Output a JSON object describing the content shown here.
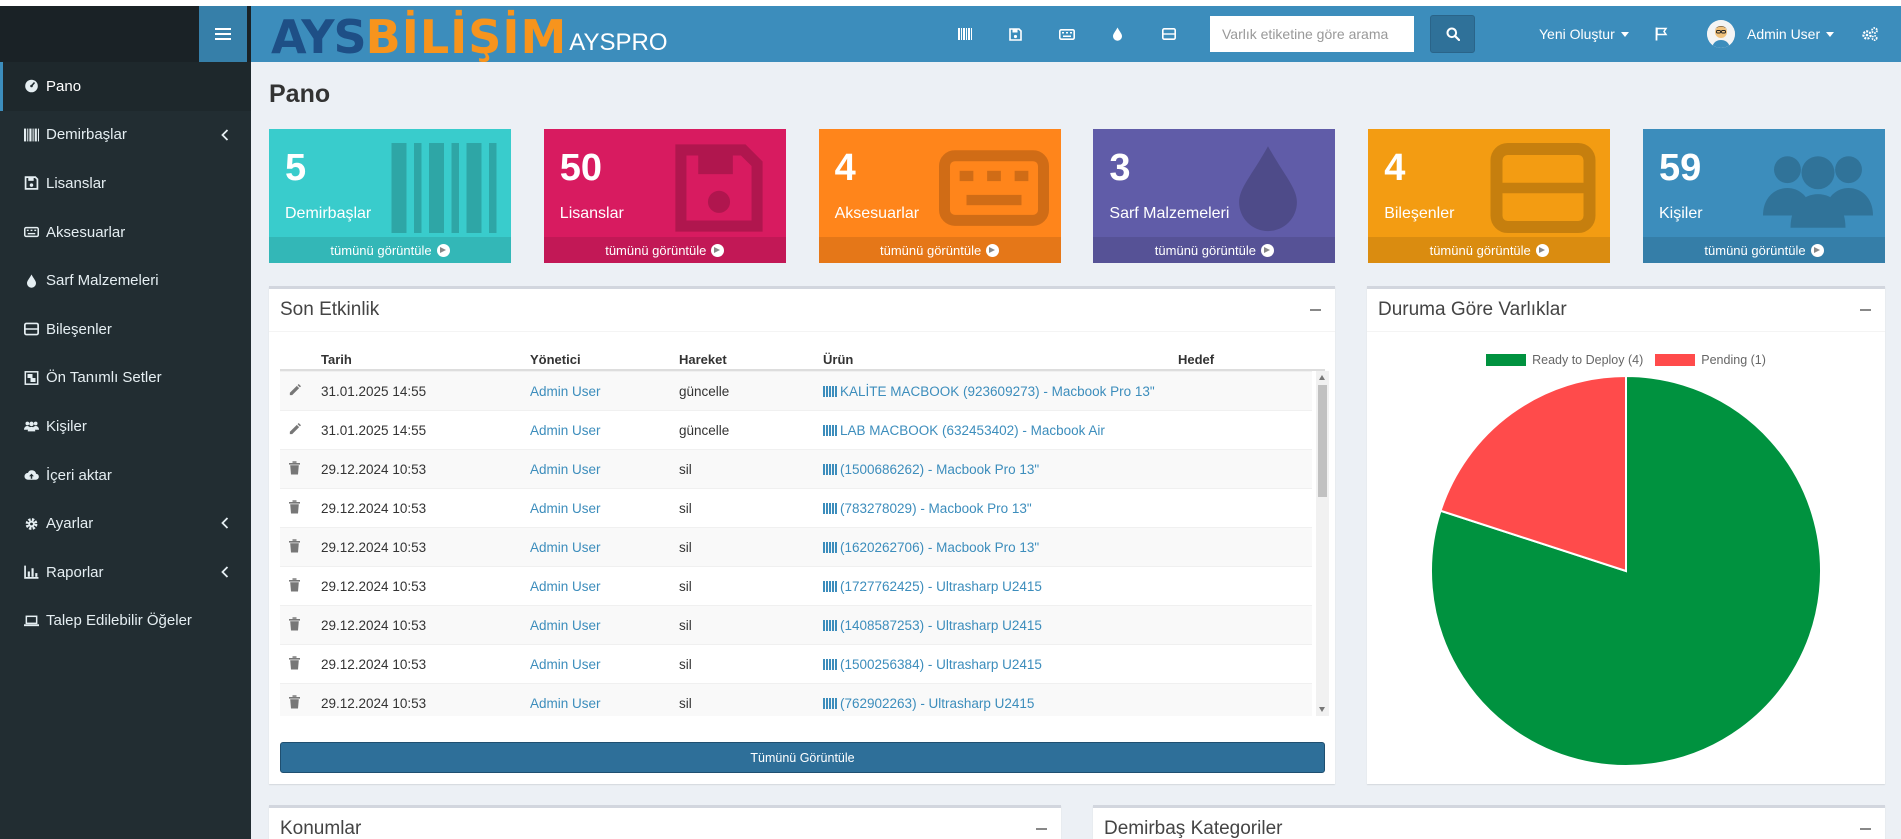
{
  "sidebar": {
    "items": [
      {
        "label": "Pano",
        "icon": "dashboard-icon",
        "active": true
      },
      {
        "label": "Demirbaşlar",
        "icon": "barcode-icon",
        "has_children": true
      },
      {
        "label": "Lisanslar",
        "icon": "floppy-disk-icon"
      },
      {
        "label": "Aksesuarlar",
        "icon": "keyboard-icon"
      },
      {
        "label": "Sarf Malzemeleri",
        "icon": "drop-icon"
      },
      {
        "label": "Bileşenler",
        "icon": "hdd-icon"
      },
      {
        "label": "Ön Tanımlı Setler",
        "icon": "object-group-icon"
      },
      {
        "label": "Kişiler",
        "icon": "users-icon"
      },
      {
        "label": "İçeri aktar",
        "icon": "cloud-upload-icon"
      },
      {
        "label": "Ayarlar",
        "icon": "gear-icon",
        "has_children": true
      },
      {
        "label": "Raporlar",
        "icon": "chart-icon",
        "has_children": true
      },
      {
        "label": "Talep Edilebilir Öğeler",
        "icon": "laptop-icon"
      }
    ]
  },
  "header": {
    "logo_ays": "AYS",
    "logo_bilisim": "BİLİŞİM",
    "app_name": "AYSPRO",
    "search_placeholder": "Varlık etiketine göre arama",
    "new_menu": "Yeni Oluştur",
    "user_name": "Admin User"
  },
  "page": {
    "title": "Pano"
  },
  "boxes": [
    {
      "count": "5",
      "label": "Demirbaşlar",
      "footer": "tümünü görüntüle",
      "color": "#39cccc",
      "icon": "barcode-icon"
    },
    {
      "count": "50",
      "label": "Lisanslar",
      "footer": "tümünü görüntüle",
      "color": "#d81b60",
      "icon": "floppy-disk-icon"
    },
    {
      "count": "4",
      "label": "Aksesuarlar",
      "footer": "tümünü görüntüle",
      "color": "#ff851b",
      "icon": "keyboard-icon"
    },
    {
      "count": "3",
      "label": "Sarf Malzemeleri",
      "footer": "tümünü görüntüle",
      "color": "#605ca8",
      "icon": "drop-icon"
    },
    {
      "count": "4",
      "label": "Bileşenler",
      "footer": "tümünü görüntüle",
      "color": "#f39c12",
      "icon": "hdd-icon"
    },
    {
      "count": "59",
      "label": "Kişiler",
      "footer": "tümünü görüntüle",
      "color": "#3c8dbc",
      "icon": "users-icon"
    }
  ],
  "activity": {
    "title": "Son Etkinlik",
    "columns": {
      "date": "Tarih",
      "admin": "Yönetici",
      "action": "Hareket",
      "item": "Ürün",
      "target": "Hedef"
    },
    "rows": [
      {
        "icon": "pencil-icon",
        "date": "31.01.2025 14:55",
        "admin": "Admin User",
        "action": "güncelle",
        "item": "KALİTE MACBOOK (923609273) - Macbook Pro 13\""
      },
      {
        "icon": "pencil-icon",
        "date": "31.01.2025 14:55",
        "admin": "Admin User",
        "action": "güncelle",
        "item": "LAB MACBOOK (632453402) - Macbook Air"
      },
      {
        "icon": "trash-icon",
        "date": "29.12.2024 10:53",
        "admin": "Admin User",
        "action": "sil",
        "item": "(1500686262) - Macbook Pro 13\""
      },
      {
        "icon": "trash-icon",
        "date": "29.12.2024 10:53",
        "admin": "Admin User",
        "action": "sil",
        "item": "(783278029) - Macbook Pro 13\""
      },
      {
        "icon": "trash-icon",
        "date": "29.12.2024 10:53",
        "admin": "Admin User",
        "action": "sil",
        "item": "(1620262706) - Macbook Pro 13\""
      },
      {
        "icon": "trash-icon",
        "date": "29.12.2024 10:53",
        "admin": "Admin User",
        "action": "sil",
        "item": "(1727762425) - Ultrasharp U2415"
      },
      {
        "icon": "trash-icon",
        "date": "29.12.2024 10:53",
        "admin": "Admin User",
        "action": "sil",
        "item": "(1408587253) - Ultrasharp U2415"
      },
      {
        "icon": "trash-icon",
        "date": "29.12.2024 10:53",
        "admin": "Admin User",
        "action": "sil",
        "item": "(1500256384) - Ultrasharp U2415"
      },
      {
        "icon": "trash-icon",
        "date": "29.12.2024 10:53",
        "admin": "Admin User",
        "action": "sil",
        "item": "(762902263) - Ultrasharp U2415"
      }
    ],
    "view_all": "Tümünü Görüntüle"
  },
  "status_panel": {
    "title": "Duruma Göre Varlıklar"
  },
  "chart_data": {
    "type": "pie",
    "categories": [
      "Ready to Deploy (4)",
      "Pending (1)"
    ],
    "values": [
      4,
      1
    ],
    "colors": [
      "#00923f",
      "#ff4b4b"
    ],
    "legend": "top"
  },
  "bottom_panels": {
    "locations": "Konumlar",
    "categories": "Demirbaş Kategoriler"
  }
}
